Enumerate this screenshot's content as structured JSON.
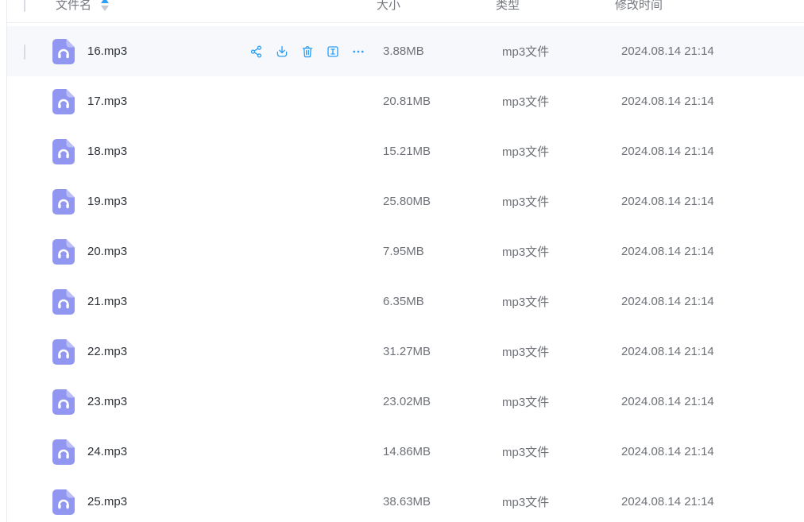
{
  "table": {
    "columns": {
      "name": "文件名",
      "size": "大小",
      "type": "类型",
      "modified": "修改时间"
    },
    "sort": {
      "column": "文件名",
      "active_direction": "asc"
    },
    "row_actions": [
      {
        "icon": "share-icon"
      },
      {
        "icon": "download-icon"
      },
      {
        "icon": "delete-icon"
      },
      {
        "icon": "rename-icon"
      },
      {
        "icon": "more-icon"
      }
    ],
    "rows": [
      {
        "name": "16.mp3",
        "size": "3.88MB",
        "type": "mp3文件",
        "modified": "2024.08.14 21:14",
        "hover": true,
        "checked": false
      },
      {
        "name": "17.mp3",
        "size": "20.81MB",
        "type": "mp3文件",
        "modified": "2024.08.14 21:14",
        "hover": false
      },
      {
        "name": "18.mp3",
        "size": "15.21MB",
        "type": "mp3文件",
        "modified": "2024.08.14 21:14",
        "hover": false
      },
      {
        "name": "19.mp3",
        "size": "25.80MB",
        "type": "mp3文件",
        "modified": "2024.08.14 21:14",
        "hover": false
      },
      {
        "name": "20.mp3",
        "size": "7.95MB",
        "type": "mp3文件",
        "modified": "2024.08.14 21:14",
        "hover": false
      },
      {
        "name": "21.mp3",
        "size": "6.35MB",
        "type": "mp3文件",
        "modified": "2024.08.14 21:14",
        "hover": false
      },
      {
        "name": "22.mp3",
        "size": "31.27MB",
        "type": "mp3文件",
        "modified": "2024.08.14 21:14",
        "hover": false
      },
      {
        "name": "23.mp3",
        "size": "23.02MB",
        "type": "mp3文件",
        "modified": "2024.08.14 21:14",
        "hover": false
      },
      {
        "name": "24.mp3",
        "size": "14.86MB",
        "type": "mp3文件",
        "modified": "2024.08.14 21:14",
        "hover": false
      },
      {
        "name": "25.mp3",
        "size": "38.63MB",
        "type": "mp3文件",
        "modified": "2024.08.14 21:14",
        "hover": false
      }
    ],
    "file_icon": "music-file-icon",
    "colors": {
      "accent_blue": "#2e9ff2",
      "file_icon_purple": "#9197f0",
      "file_icon_fold": "#babdf6",
      "hover_row_bg": "#f7f8fc",
      "grey_text": "#6e7278",
      "dark_text": "#2e3237"
    }
  }
}
